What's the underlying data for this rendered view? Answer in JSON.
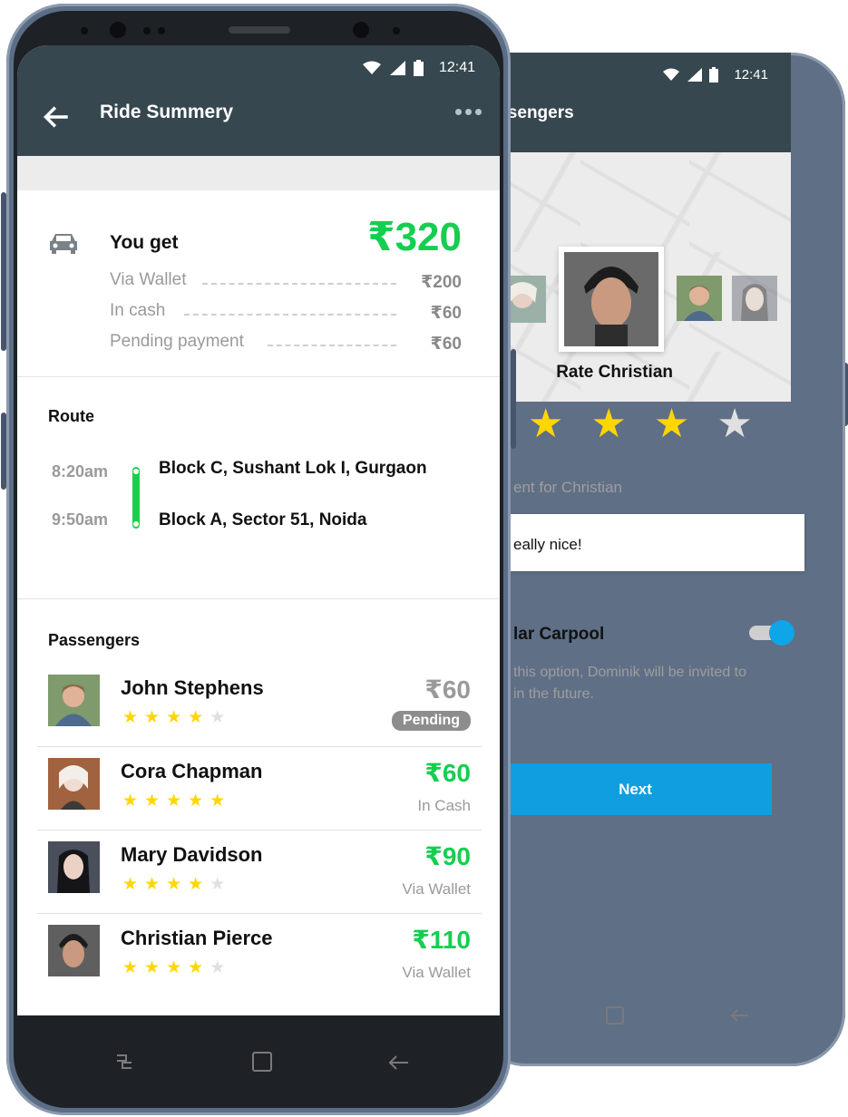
{
  "colors": {
    "topbar": "#37474f",
    "accent_green": "#14cf4f",
    "star": "#ffd600",
    "star_empty": "#e0e0e0",
    "next_button": "#0f9fe0",
    "toggle": "#0ea5e9",
    "pending_badge": "#8d8d8d"
  },
  "front": {
    "status": {
      "time": "12:41",
      "icons": [
        "wifi-icon",
        "signal-icon",
        "battery-icon"
      ]
    },
    "header": {
      "title": "Ride Summery",
      "back_icon": "arrow-left-icon",
      "menu_icon": "more-horizontal-icon"
    },
    "earnings": {
      "label": "You get",
      "total": "₹320",
      "icon": "car-icon",
      "rows": [
        {
          "label": "Via Wallet",
          "amount": "₹200"
        },
        {
          "label": "In cash",
          "amount": "₹60"
        },
        {
          "label": "Pending payment",
          "amount": "₹60"
        }
      ]
    },
    "route": {
      "title": "Route",
      "stops": [
        {
          "time": "8:20am",
          "place": "Block C, Sushant Lok I, Gurgaon"
        },
        {
          "time": "9:50am",
          "place": "Block A, Sector 51, Noida"
        }
      ]
    },
    "passengers": {
      "title": "Passengers",
      "items": [
        {
          "name": "John Stephens",
          "rating": 4,
          "amount": "₹60",
          "status": "Pending",
          "amount_color": "#9a9a9a"
        },
        {
          "name": "Cora Chapman",
          "rating": 5,
          "amount": "₹60",
          "status": "In Cash",
          "amount_color": "#14cf4f"
        },
        {
          "name": "Mary Davidson",
          "rating": 4,
          "amount": "₹90",
          "status": "Via Wallet",
          "amount_color": "#14cf4f"
        },
        {
          "name": "Christian Pierce",
          "rating": 4,
          "amount": "₹110",
          "status": "Via Wallet",
          "amount_color": "#14cf4f"
        }
      ]
    },
    "navbar": [
      "recent-apps-icon",
      "home-square-icon",
      "back-arrow-icon"
    ]
  },
  "back": {
    "status": {
      "time": "12:41"
    },
    "header": {
      "title": "Passengers"
    },
    "rate": {
      "title": "Rate Christian",
      "rating": 3
    },
    "comment": {
      "label": "ent for Christian",
      "value": "eally nice!"
    },
    "carpool": {
      "title": "lar Carpool",
      "enabled": true,
      "description": "this option, Dominik will be invited to\nin the future."
    },
    "next_label": "Next",
    "navbar": [
      "home-square-icon",
      "back-arrow-icon"
    ]
  }
}
